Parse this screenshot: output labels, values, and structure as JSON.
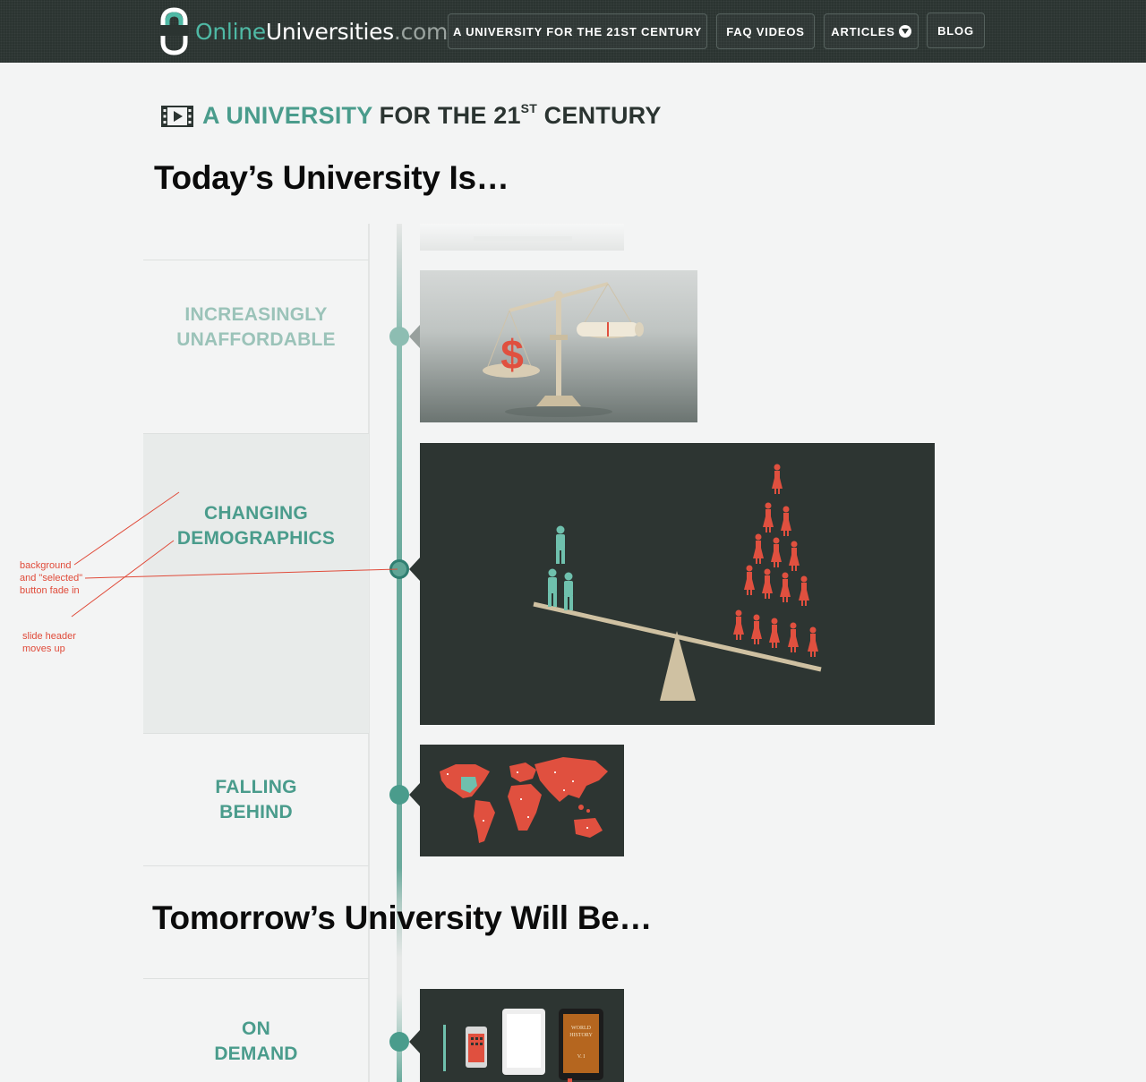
{
  "header": {
    "logo": {
      "part1": "Online",
      "part2": "Universities",
      "part3": ".com"
    },
    "nav": [
      {
        "label": "A UNIVERSITY FOR THE 21ST CENTURY"
      },
      {
        "label": "FAQ VIDEOS"
      },
      {
        "label": "ARTICLES",
        "icon": "chevron-down-circle-icon"
      },
      {
        "label": "BLOG"
      }
    ]
  },
  "page_title": {
    "accent": "A UNIVERSITY",
    "rest": "FOR THE 21",
    "sup": "ST",
    "end": "CENTURY",
    "icon": "film-play-icon"
  },
  "sections": {
    "today": "Today’s University Is…",
    "tomorrow": "Tomorrow’s University Will Be…"
  },
  "timeline": [
    {
      "line1": "INCREASINGLY",
      "line2": "UNAFFORDABLE",
      "state": "faded",
      "color": "#9bc3b9"
    },
    {
      "line1": "CHANGING",
      "line2": "DEMOGRAPHICS",
      "state": "selected",
      "color": "#4a9c8c"
    },
    {
      "line1": "FALLING",
      "line2": "BEHIND",
      "state": "normal",
      "color": "#4a9c8c"
    },
    {
      "line1": "ON",
      "line2": "DEMAND",
      "state": "normal",
      "color": "#4a9c8c"
    }
  ],
  "illustrations": {
    "book_title": "WORLD HISTORY",
    "book_volume": "V. I"
  },
  "annotations": [
    {
      "text": [
        "background",
        "and \"selected\"",
        "button fade in"
      ]
    },
    {
      "text": [
        "slide header",
        "moves up"
      ]
    }
  ],
  "colors": {
    "accent": "#4a9c8c",
    "dark": "#2d3532",
    "red": "#e04b3a",
    "bg": "#f3f4f4"
  }
}
